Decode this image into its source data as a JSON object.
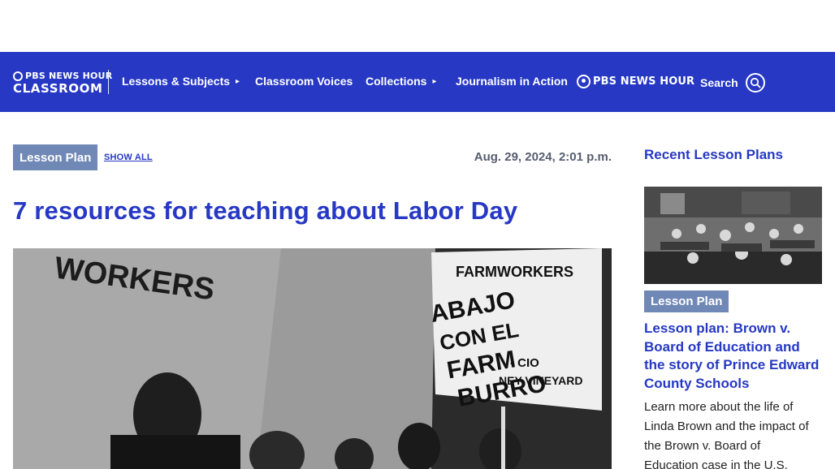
{
  "brand": {
    "logo_top": "PBS NEWS HOUR",
    "logo_bottom": "CLASSROOM",
    "partner_logo": "PBS NEWS HOUR"
  },
  "nav": {
    "lessons": "Lessons & Subjects",
    "voices": "Classroom Voices",
    "collections": "Collections",
    "journalism": "Journalism in Action",
    "search": "Search",
    "arrow": "▸"
  },
  "article": {
    "tag": "Lesson Plan",
    "show_all": "SHOW ALL",
    "date": "Aug. 29, 2024, 2:01 p.m.",
    "title": "7 resources for teaching about Labor Day"
  },
  "hero_image": {
    "banner_left": "WORKERS",
    "sign_top": "FARMWORKERS",
    "sign_lines": [
      "ABAJO",
      "CON EL",
      "FARM",
      "BURRO"
    ],
    "sign_small": [
      "- CIO",
      "NEY VINEYARD"
    ]
  },
  "sidebar": {
    "title": "Recent Lesson Plans",
    "tag": "Lesson Plan",
    "heading": "Lesson plan: Brown v. Board of Education and the story of Prince Edward County Schools",
    "description": "Learn more about the life of Linda Brown and the impact of the Brown v. Board of Education case in the U.S."
  },
  "colors": {
    "nav_bg": "#2638c4",
    "accent_blue": "#2638c4",
    "tag_bg": "#7088b6",
    "date_gray": "#555d6e"
  },
  "icons": [
    "pbs-logo-icon",
    "triangle-right-icon",
    "search-icon"
  ]
}
